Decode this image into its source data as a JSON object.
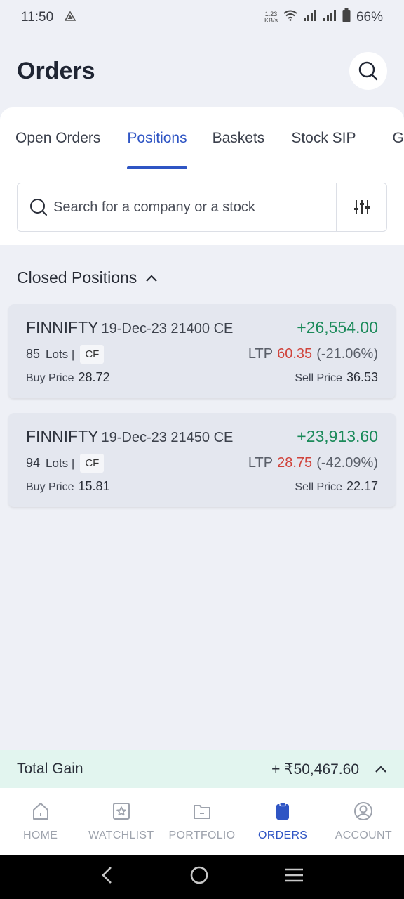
{
  "status_bar": {
    "time": "11:50",
    "net_speed_value": "1.23",
    "net_speed_unit": "KB/s",
    "battery": "66%"
  },
  "header": {
    "title": "Orders"
  },
  "tabs": [
    {
      "label": "Open Orders",
      "active": false
    },
    {
      "label": "Positions",
      "active": true
    },
    {
      "label": "Baskets",
      "active": false
    },
    {
      "label": "Stock SIP",
      "active": false
    },
    {
      "label": "GTT",
      "active": false
    }
  ],
  "search": {
    "placeholder": "Search for a company or a stock"
  },
  "section": {
    "title": "Closed Positions"
  },
  "positions": [
    {
      "symbol": "FINNIFTY",
      "contract": "19-Dec-23 21400 CE",
      "pnl": "+26,554.00",
      "lots": "85",
      "lots_label": "Lots |",
      "badge": "CF",
      "ltp_label": "LTP",
      "ltp": "60.35",
      "ltp_change": "(-21.06%)",
      "buy_label": "Buy Price",
      "buy_price": "28.72",
      "sell_label": "Sell Price",
      "sell_price": "36.53"
    },
    {
      "symbol": "FINNIFTY",
      "contract": "19-Dec-23 21450 CE",
      "pnl": "+23,913.60",
      "lots": "94",
      "lots_label": "Lots |",
      "badge": "CF",
      "ltp_label": "LTP",
      "ltp": "28.75",
      "ltp_change": "(-42.09%)",
      "buy_label": "Buy Price",
      "buy_price": "15.81",
      "sell_label": "Sell Price",
      "sell_price": "22.17"
    }
  ],
  "total": {
    "label": "Total Gain",
    "value": "+ ₹50,467.60"
  },
  "bottom_nav": [
    {
      "label": "HOME",
      "icon": "home-icon",
      "active": false
    },
    {
      "label": "WATCHLIST",
      "icon": "star-icon",
      "active": false
    },
    {
      "label": "PORTFOLIO",
      "icon": "folder-icon",
      "active": false
    },
    {
      "label": "ORDERS",
      "icon": "clipboard-icon",
      "active": true
    },
    {
      "label": "ACCOUNT",
      "icon": "user-icon",
      "active": false
    }
  ],
  "colors": {
    "accent": "#2f55c4",
    "gain": "#1b8a5a",
    "loss": "#d0433b",
    "total_bar_bg": "#e2f5ef"
  }
}
